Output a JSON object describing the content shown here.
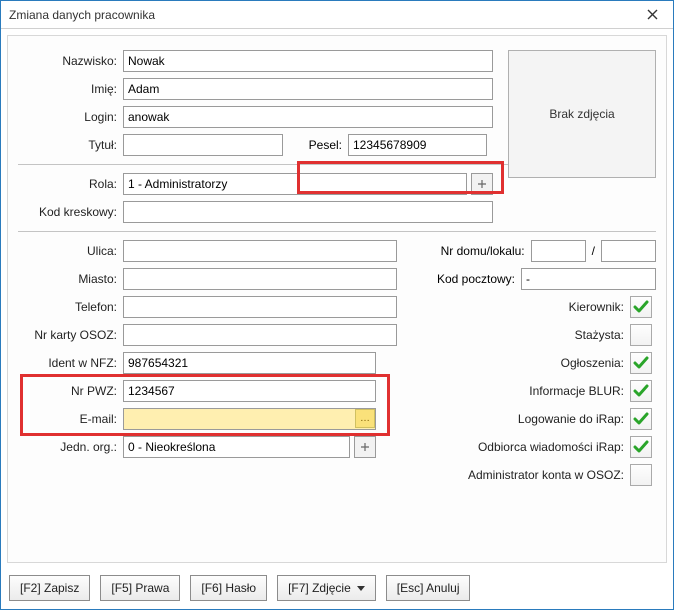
{
  "window": {
    "title": "Zmiana danych pracownika"
  },
  "photo_placeholder": "Brak zdjęcia",
  "labels": {
    "nazwisko": "Nazwisko:",
    "imie": "Imię:",
    "login": "Login:",
    "tytul": "Tytuł:",
    "pesel": "Pesel:",
    "rola": "Rola:",
    "kod_kreskowy": "Kod kreskowy:",
    "ulica": "Ulica:",
    "nr_domu": "Nr domu/lokalu:",
    "slash": "/",
    "miasto": "Miasto:",
    "kod_pocztowy": "Kod pocztowy:",
    "telefon": "Telefon:",
    "nr_karty_osoz": "Nr karty OSOZ:",
    "ident_nfz": "Ident w NFZ:",
    "nr_pwz": "Nr PWZ:",
    "email": "E-mail:",
    "jedn_org": "Jedn. org.:"
  },
  "values": {
    "nazwisko": "Nowak",
    "imie": "Adam",
    "login": "anowak",
    "tytul": "",
    "pesel": "12345678909",
    "rola": "1 - Administratorzy",
    "kod_kreskowy": "",
    "ulica": "",
    "nr_domu": "",
    "nr_lokalu": "",
    "miasto": "",
    "kod_pocztowy": "-",
    "telefon": "",
    "nr_karty_osoz": "",
    "ident_nfz": "987654321",
    "nr_pwz": "1234567",
    "email": "",
    "jedn_org": "0 - Nieokreślona"
  },
  "checks": {
    "kierownik": {
      "label": "Kierownik:",
      "checked": true
    },
    "stazysta": {
      "label": "Stażysta:",
      "checked": false
    },
    "ogloszenia": {
      "label": "Ogłoszenia:",
      "checked": true
    },
    "blur": {
      "label": "Informacje BLUR:",
      "checked": true
    },
    "irap_login": {
      "label": "Logowanie do iRap:",
      "checked": true
    },
    "irap_odbiorca": {
      "label": "Odbiorca wiadomości iRap:",
      "checked": true
    },
    "osoz_admin": {
      "label": "Administrator konta w OSOZ:",
      "checked": false
    }
  },
  "buttons": {
    "zapisz": "[F2] Zapisz",
    "prawa": "[F5] Prawa",
    "haslo": "[F6] Hasło",
    "zdjecie": "[F7] Zdjęcie",
    "anuluj": "[Esc] Anuluj"
  }
}
